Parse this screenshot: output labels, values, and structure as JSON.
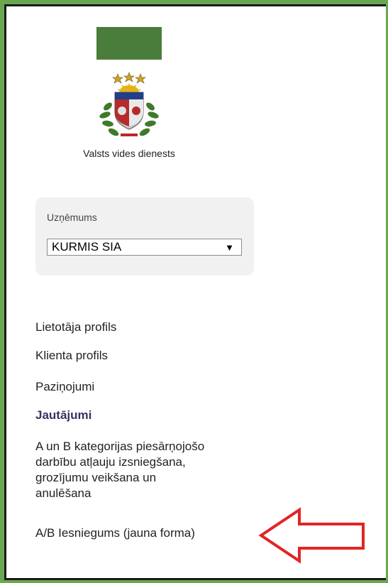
{
  "brand": {
    "name": "Valsts vides dienests",
    "colors": {
      "frame": "#6aa84f",
      "banner": "#4a7d3c"
    }
  },
  "company": {
    "label": "Uzņēmums",
    "selected": "KURMIS SIA",
    "arrow": "▼"
  },
  "nav": {
    "items": [
      {
        "label": "Lietotāja profils",
        "active": false
      },
      {
        "label": "Klienta profils",
        "active": false
      },
      {
        "label": "Paziņojumi",
        "active": false
      },
      {
        "label": "Jautājumi",
        "active": true
      },
      {
        "label_lines": [
          "A un B kategorijas piesārņojošo",
          "darbību atļauju izsniegšana,",
          "grozījumu veikšana un",
          "anulēšana"
        ],
        "active": false
      },
      {
        "label": "A/B Iesniegums (jauna forma)",
        "active": false
      }
    ]
  },
  "annotation": {
    "icon": "red-arrow-left-icon",
    "color": "#e32424"
  }
}
